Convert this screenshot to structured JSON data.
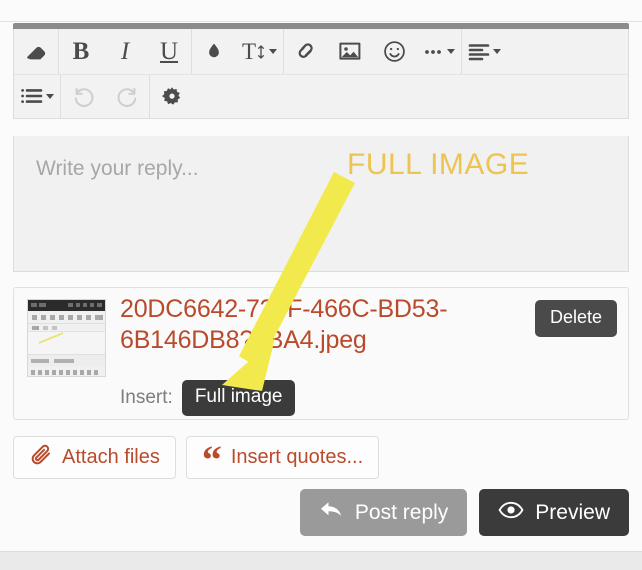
{
  "composer": {
    "drag_handle": "drag-handle",
    "toolbar": {
      "row1": [
        {
          "name": "eraser-icon",
          "label": "Remove formatting",
          "icon": "eraser",
          "caret": false,
          "disabled": false,
          "group_end": true
        },
        {
          "name": "bold-icon",
          "label": "B",
          "icon": "bold",
          "caret": false,
          "disabled": false,
          "group_end": false
        },
        {
          "name": "italic-icon",
          "label": "I",
          "icon": "italic",
          "caret": false,
          "disabled": false,
          "group_end": false
        },
        {
          "name": "underline-icon",
          "label": "U",
          "icon": "underline",
          "caret": false,
          "disabled": false,
          "group_end": true
        },
        {
          "name": "text-color-icon",
          "label": "Text color",
          "icon": "droplet",
          "caret": false,
          "disabled": false,
          "group_end": false
        },
        {
          "name": "font-size-icon",
          "label": "T",
          "icon": "textsize",
          "caret": true,
          "disabled": false,
          "group_end": true
        },
        {
          "name": "link-icon",
          "label": "Insert link",
          "icon": "link",
          "caret": false,
          "disabled": false,
          "group_end": false
        },
        {
          "name": "image-icon",
          "label": "Insert image",
          "icon": "image",
          "caret": false,
          "disabled": false,
          "group_end": false
        },
        {
          "name": "smiley-icon",
          "label": "Insert emoji",
          "icon": "smiley",
          "caret": false,
          "disabled": false,
          "group_end": false
        },
        {
          "name": "more-options-icon",
          "label": "More",
          "icon": "ellipsis",
          "caret": true,
          "disabled": false,
          "group_end": true
        },
        {
          "name": "align-icon",
          "label": "Alignment",
          "icon": "align",
          "caret": true,
          "disabled": false,
          "group_end": false
        }
      ],
      "row2": [
        {
          "name": "list-icon",
          "label": "Lists",
          "icon": "list",
          "caret": true,
          "disabled": false,
          "group_end": true
        },
        {
          "name": "undo-icon",
          "label": "Undo",
          "icon": "undo",
          "caret": false,
          "disabled": true,
          "group_end": false
        },
        {
          "name": "redo-icon",
          "label": "Redo",
          "icon": "redo",
          "caret": false,
          "disabled": true,
          "group_end": true
        },
        {
          "name": "settings-gear-icon",
          "label": "Settings",
          "icon": "gear",
          "caret": false,
          "disabled": false,
          "group_end": false
        }
      ]
    },
    "reply": {
      "placeholder": "Write your reply...",
      "value": ""
    }
  },
  "attachment": {
    "filename": "20DC6642-7?0F-466C-BD53-6B146DB8??BA4.jpeg",
    "insert_label": "Insert:",
    "insert_option": "Full image",
    "delete_label": "Delete",
    "thumbnail_alt": "screenshot thumbnail"
  },
  "actions": {
    "attach_files": "Attach files",
    "insert_quotes": "Insert quotes...",
    "post_reply": "Post reply",
    "preview": "Preview"
  },
  "annotation": {
    "text": "FULL IMAGE",
    "color": "#edc44f",
    "arrow_color": "#f2ea4c"
  },
  "colors": {
    "accent_link": "#b94a2c",
    "button_dark": "#3b3b3b",
    "button_muted": "#9a9a9a",
    "toolbar_bg": "#f2f2f2",
    "reply_bg": "#f1f1f1"
  }
}
